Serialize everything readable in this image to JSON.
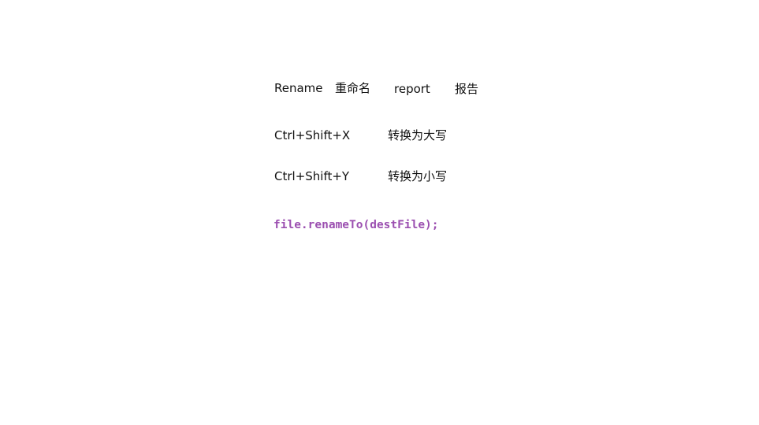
{
  "vocab": {
    "word_en": "Rename",
    "word_zh": "重命名",
    "word2_en": "report",
    "word2_zh": "报告"
  },
  "shortcuts": [
    {
      "keys": "Ctrl+Shift+X",
      "description": "转换为大写"
    },
    {
      "keys": "Ctrl+Shift+Y",
      "description": "转换为小写"
    }
  ],
  "code": {
    "line": "file.renameTo(destFile);",
    "color": "#9B4FB0"
  },
  "colors": {
    "background": "#ffffff",
    "text": "#111111"
  }
}
